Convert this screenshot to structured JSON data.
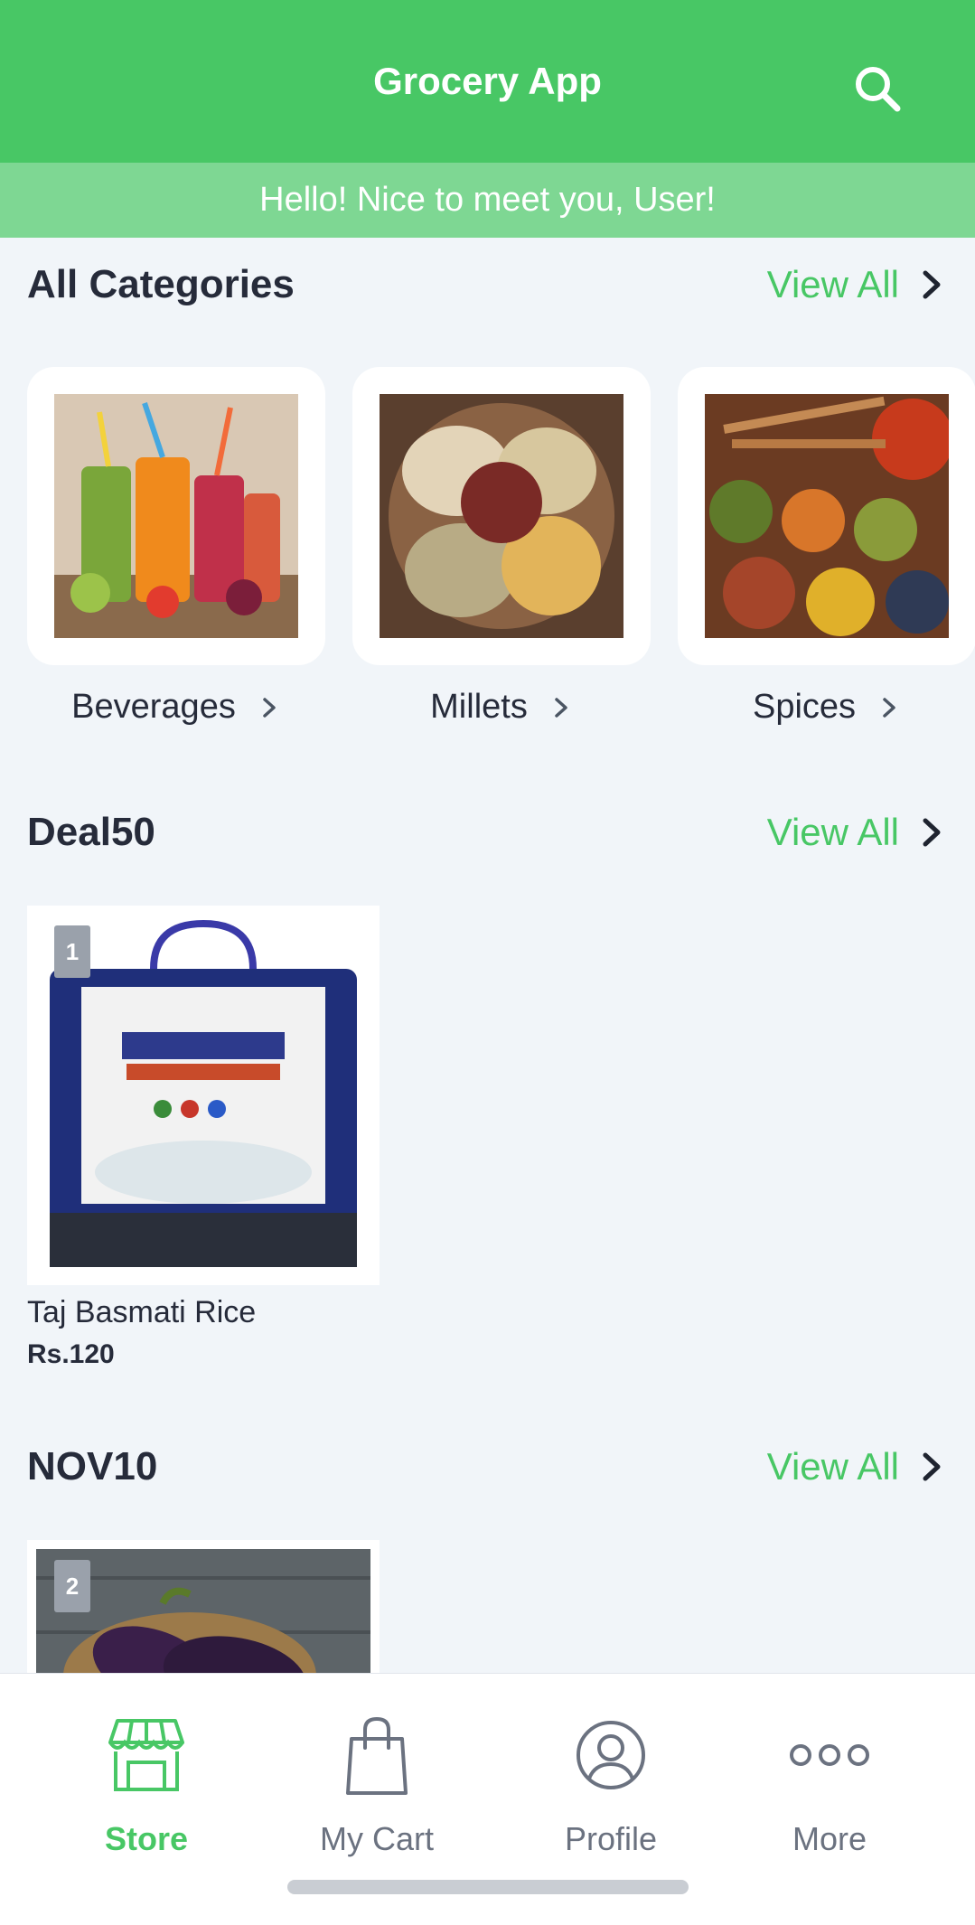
{
  "header": {
    "title": "Grocery App",
    "search_icon": "search-icon"
  },
  "greeting": "Hello! Nice to meet you, User!",
  "categories_section": {
    "title": "All Categories",
    "view_all": "View All",
    "items": [
      {
        "label": "Beverages"
      },
      {
        "label": "Millets"
      },
      {
        "label": "Spices"
      }
    ]
  },
  "deal_section": {
    "title": "Deal50",
    "view_all": "View All",
    "products": [
      {
        "badge": "1",
        "name": "Taj Basmati Rice",
        "price": "Rs.120"
      }
    ]
  },
  "nov_section": {
    "title": "NOV10",
    "view_all": "View All",
    "products": [
      {
        "badge": "2"
      }
    ]
  },
  "tabbar": {
    "accent": "#48c765",
    "items": [
      {
        "label": "Store",
        "icon": "store-icon",
        "active": true
      },
      {
        "label": "My Cart",
        "icon": "shopping-bag-icon",
        "active": false
      },
      {
        "label": "Profile",
        "icon": "user-icon",
        "active": false
      },
      {
        "label": "More",
        "icon": "more-dots-icon",
        "active": false
      }
    ]
  }
}
